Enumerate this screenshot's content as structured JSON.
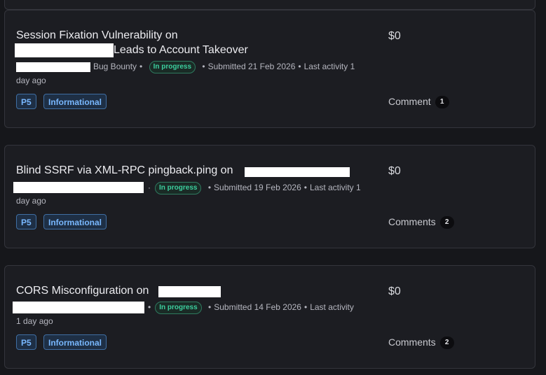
{
  "reports": [
    {
      "title_line1": "Session Fixation Vulnerability on",
      "title_line2": "Leads to Account Takeover",
      "program_suffix": "Bug Bounty",
      "status": "In progress",
      "submitted": "Submitted 21 Feb 2026",
      "last_activity_a": "Last activity 1",
      "last_activity_b": "day ago",
      "priority": "P5",
      "severity": "Informational",
      "bounty": "$0",
      "comments_label": "Comment",
      "comments_count": "1"
    },
    {
      "title_line1": "Blind SSRF via XML-RPC pingback.ping on",
      "status": "In progress",
      "submitted": "Submitted 19 Feb 2026",
      "last_activity_a": "Last activity 1",
      "last_activity_b": "day ago",
      "priority": "P5",
      "severity": "Informational",
      "bounty": "$0",
      "comments_label": "Comments",
      "comments_count": "2"
    },
    {
      "title_line1": "CORS Misconfiguration on",
      "status": "In progress",
      "submitted": "Submitted 14 Feb 2026",
      "last_activity_a": "Last activity",
      "last_activity_b": "1 day ago",
      "priority": "P5",
      "severity": "Informational",
      "bounty": "$0",
      "comments_label": "Comments",
      "comments_count": "2"
    }
  ],
  "colors": {
    "background": "#16171b",
    "card": "#1c1d22",
    "status_green": "#3ccf9e",
    "badge_blue": "#79b8ff"
  }
}
